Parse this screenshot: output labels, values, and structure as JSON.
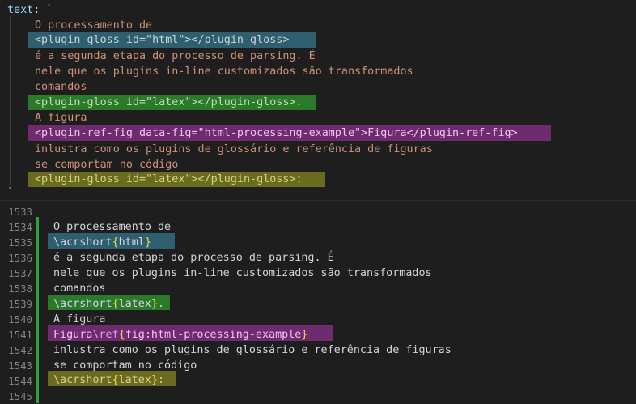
{
  "top": {
    "key": "text",
    "colon": ": ",
    "open_tick": "`",
    "close_tick": "`",
    "lines": [
      "O processamento de",
      "<plugin-gloss id=\"html\"></plugin-gloss>",
      "é a segunda etapa do processo de parsing. É",
      "nele que os plugins in-line customizados são transformados",
      "comandos",
      "<plugin-gloss id=\"latex\"></plugin-gloss>.",
      "A figura",
      "<plugin-ref-fig data-fig=\"html-processing-example\">Figura</plugin-ref-fig>",
      "inlustra como os plugins de glossário e referência de figuras",
      "se comportam no código",
      "<plugin-gloss id=\"latex\"></plugin-gloss>:"
    ]
  },
  "bottom": {
    "line_numbers": [
      "1533",
      "1534",
      "1535",
      "1536",
      "1537",
      "1538",
      "1539",
      "1540",
      "1541",
      "1542",
      "1543",
      "1544",
      "1545"
    ],
    "line1": "O processamento de",
    "acr1": {
      "cmd": "\\acrshort",
      "open": "{",
      "arg": "html",
      "close": "}"
    },
    "line3": "é a segunda etapa do processo de parsing. É",
    "line4": "nele que os plugins in-line customizados são transformados",
    "line5": "comandos",
    "acr2": {
      "cmd": "\\acrshort",
      "open": "{",
      "arg": "latex",
      "close": "}",
      "suffix": "."
    },
    "line7": "A figura",
    "ref": {
      "text": "Figura",
      "cmd": "\\ref",
      "open": "{",
      "arg": "fig:html-processing-example",
      "close": "}"
    },
    "line9": "inlustra como os plugins de glossário e referência de figuras",
    "line10": "se comportam no código",
    "acr3": {
      "cmd": "\\acrshort",
      "open": "{",
      "arg": "latex",
      "close": "}",
      "suffix": ":"
    }
  },
  "colors": {
    "highlight_blue": "#2e5f6e",
    "highlight_green": "#2a7a2a",
    "highlight_purple": "#6e2b6e",
    "highlight_olive": "#6b6b1f",
    "git_added": "#2ea043",
    "background": "#1e1e1e"
  }
}
